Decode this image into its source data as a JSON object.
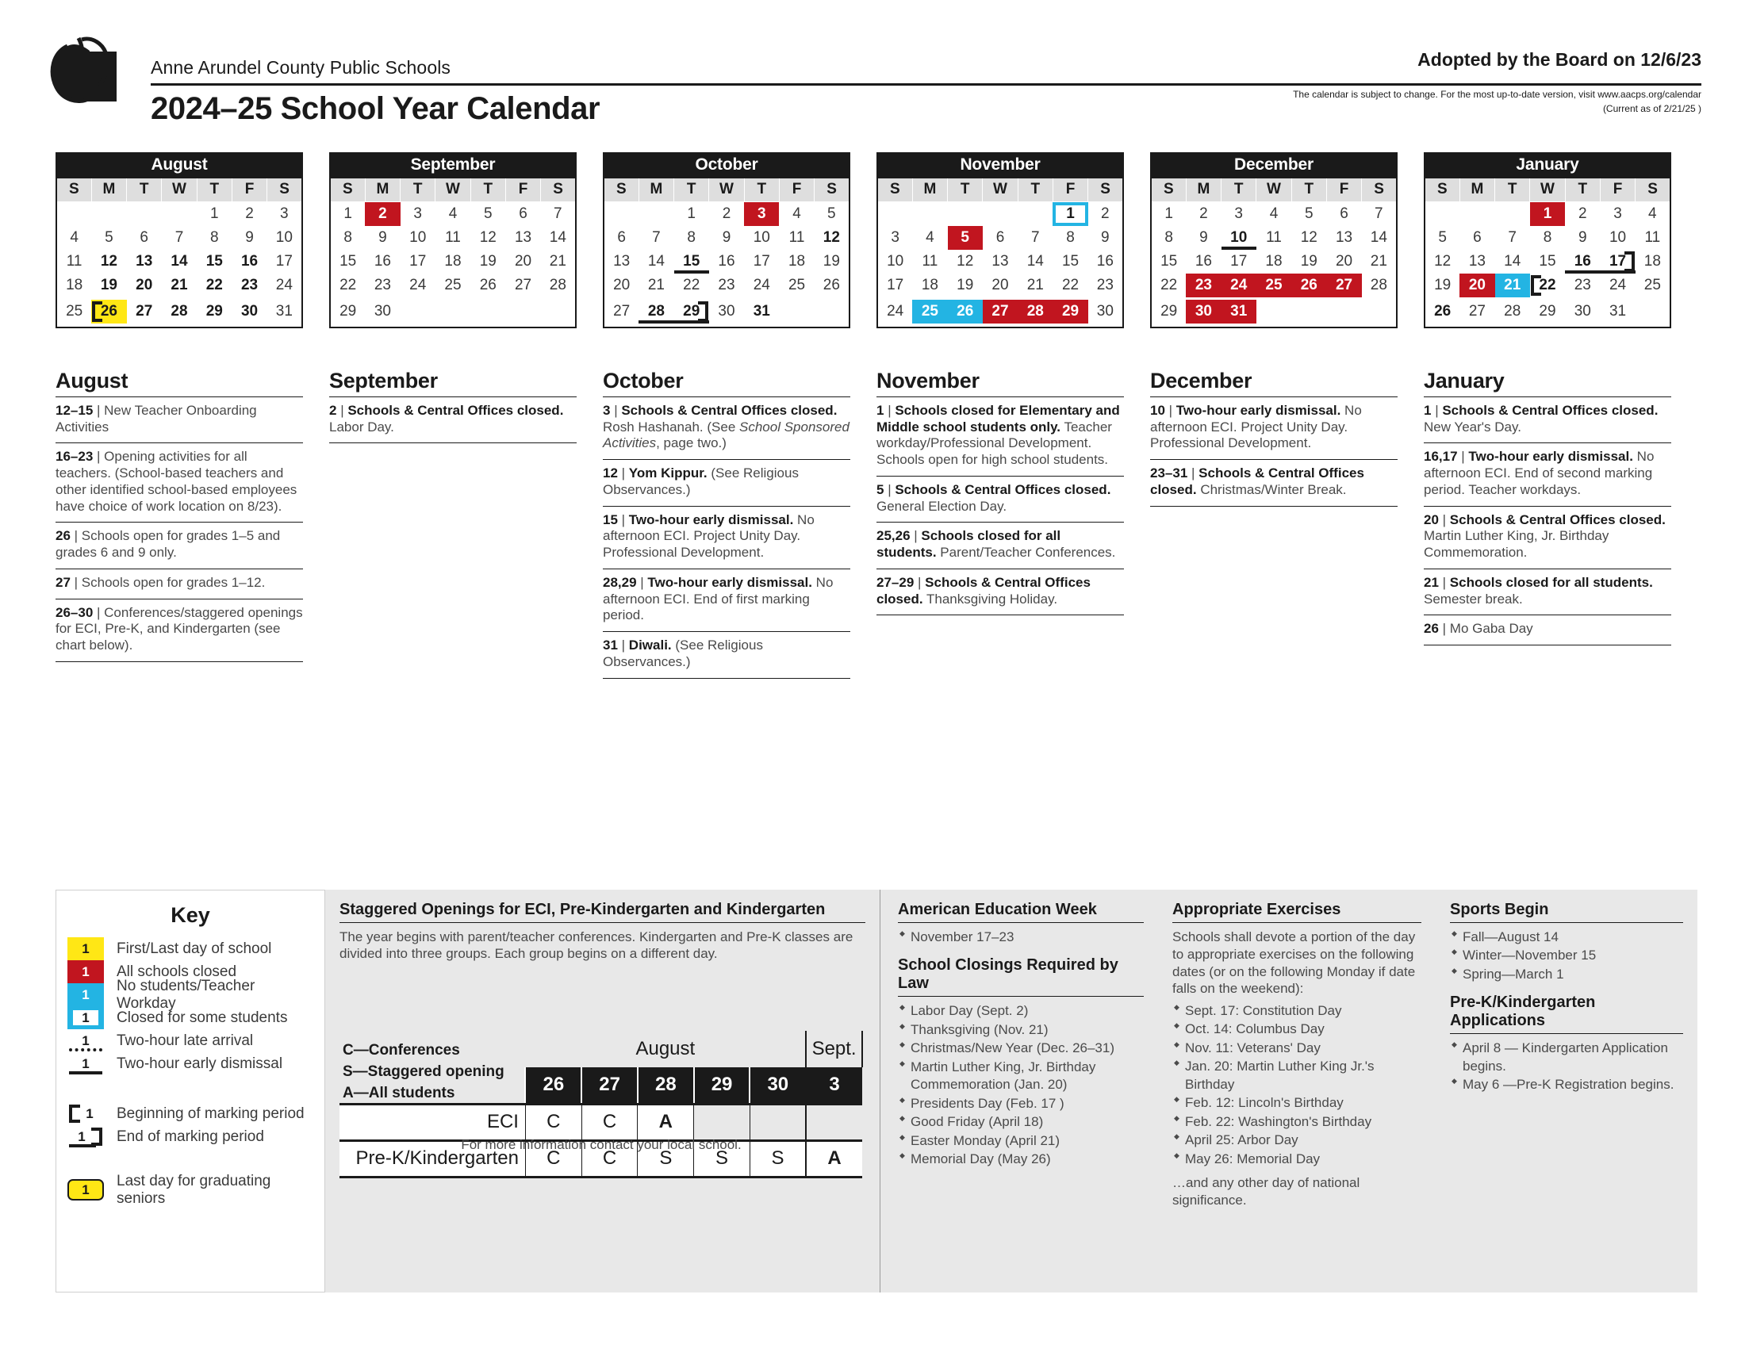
{
  "header": {
    "org": "Anne Arundel County Public Schools",
    "title": "2024–25 School Year Calendar",
    "adopted": "Adopted by the Board on 12/6/23",
    "note1": "The calendar is subject to change. For the most up-to-date version, visit www.aacps.org/calendar",
    "note2": "(Current as of 2/21/25 )",
    "logo_icon": "apple-logo-icon"
  },
  "colors": {
    "red": "#c1151f",
    "cyan": "#23b4e3",
    "yellow": "#ffe715",
    "black": "#1a1a1a",
    "header_gray": "#dedede",
    "panel_gray": "#e8e8e8"
  },
  "weekday_headers": [
    "S",
    "M",
    "T",
    "W",
    "T",
    "F",
    "S"
  ],
  "months": [
    {
      "name": "August",
      "weeks": [
        [
          null,
          null,
          null,
          null,
          {
            "d": "1"
          },
          {
            "d": "2"
          },
          {
            "d": "3"
          }
        ],
        [
          {
            "d": "4"
          },
          {
            "d": "5"
          },
          {
            "d": "6"
          },
          {
            "d": "7"
          },
          {
            "d": "8"
          },
          {
            "d": "9"
          },
          {
            "d": "10"
          }
        ],
        [
          {
            "d": "11"
          },
          {
            "d": "12",
            "s": "bold"
          },
          {
            "d": "13",
            "s": "bold"
          },
          {
            "d": "14",
            "s": "bold"
          },
          {
            "d": "15",
            "s": "bold"
          },
          {
            "d": "16",
            "s": "bold"
          },
          {
            "d": "17"
          }
        ],
        [
          {
            "d": "18"
          },
          {
            "d": "19",
            "s": "bold"
          },
          {
            "d": "20",
            "s": "bold"
          },
          {
            "d": "21",
            "s": "bold"
          },
          {
            "d": "22",
            "s": "bold"
          },
          {
            "d": "23",
            "s": "bold"
          },
          {
            "d": "24"
          }
        ],
        [
          {
            "d": "25"
          },
          {
            "d": "26",
            "s": "yellow mp-start"
          },
          {
            "d": "27",
            "s": "bold"
          },
          {
            "d": "28",
            "s": "bold"
          },
          {
            "d": "29",
            "s": "bold"
          },
          {
            "d": "30",
            "s": "bold"
          },
          {
            "d": "31"
          }
        ]
      ]
    },
    {
      "name": "September",
      "weeks": [
        [
          {
            "d": "1"
          },
          {
            "d": "2",
            "s": "red"
          },
          {
            "d": "3"
          },
          {
            "d": "4"
          },
          {
            "d": "5"
          },
          {
            "d": "6"
          },
          {
            "d": "7"
          }
        ],
        [
          {
            "d": "8"
          },
          {
            "d": "9"
          },
          {
            "d": "10"
          },
          {
            "d": "11"
          },
          {
            "d": "12"
          },
          {
            "d": "13"
          },
          {
            "d": "14"
          }
        ],
        [
          {
            "d": "15"
          },
          {
            "d": "16"
          },
          {
            "d": "17"
          },
          {
            "d": "18"
          },
          {
            "d": "19"
          },
          {
            "d": "20"
          },
          {
            "d": "21"
          }
        ],
        [
          {
            "d": "22"
          },
          {
            "d": "23"
          },
          {
            "d": "24"
          },
          {
            "d": "25"
          },
          {
            "d": "26"
          },
          {
            "d": "27"
          },
          {
            "d": "28"
          }
        ],
        [
          {
            "d": "29"
          },
          {
            "d": "30"
          },
          null,
          null,
          null,
          null,
          null
        ]
      ]
    },
    {
      "name": "October",
      "weeks": [
        [
          null,
          null,
          {
            "d": "1"
          },
          {
            "d": "2"
          },
          {
            "d": "3",
            "s": "red"
          },
          {
            "d": "4"
          },
          {
            "d": "5"
          }
        ],
        [
          {
            "d": "6"
          },
          {
            "d": "7"
          },
          {
            "d": "8"
          },
          {
            "d": "9"
          },
          {
            "d": "10"
          },
          {
            "d": "11"
          },
          {
            "d": "12",
            "s": "bold"
          }
        ],
        [
          {
            "d": "13"
          },
          {
            "d": "14"
          },
          {
            "d": "15",
            "s": "bold under"
          },
          {
            "d": "16"
          },
          {
            "d": "17"
          },
          {
            "d": "18"
          },
          {
            "d": "19"
          }
        ],
        [
          {
            "d": "20"
          },
          {
            "d": "21"
          },
          {
            "d": "22"
          },
          {
            "d": "23"
          },
          {
            "d": "24"
          },
          {
            "d": "25"
          },
          {
            "d": "26"
          }
        ],
        [
          {
            "d": "27"
          },
          {
            "d": "28",
            "s": "bold under"
          },
          {
            "d": "29",
            "s": "bold under mp-end"
          },
          {
            "d": "30"
          },
          {
            "d": "31",
            "s": "bold"
          },
          null,
          null
        ]
      ]
    },
    {
      "name": "November",
      "weeks": [
        [
          null,
          null,
          null,
          null,
          null,
          {
            "d": "1",
            "s": "outline"
          },
          {
            "d": "2"
          }
        ],
        [
          {
            "d": "3"
          },
          {
            "d": "4"
          },
          {
            "d": "5",
            "s": "red"
          },
          {
            "d": "6"
          },
          {
            "d": "7"
          },
          {
            "d": "8"
          },
          {
            "d": "9"
          }
        ],
        [
          {
            "d": "10"
          },
          {
            "d": "11"
          },
          {
            "d": "12"
          },
          {
            "d": "13"
          },
          {
            "d": "14"
          },
          {
            "d": "15"
          },
          {
            "d": "16"
          }
        ],
        [
          {
            "d": "17"
          },
          {
            "d": "18"
          },
          {
            "d": "19"
          },
          {
            "d": "20"
          },
          {
            "d": "21"
          },
          {
            "d": "22"
          },
          {
            "d": "23"
          }
        ],
        [
          {
            "d": "24"
          },
          {
            "d": "25",
            "s": "cyan"
          },
          {
            "d": "26",
            "s": "cyan"
          },
          {
            "d": "27",
            "s": "red"
          },
          {
            "d": "28",
            "s": "red"
          },
          {
            "d": "29",
            "s": "red"
          },
          {
            "d": "30"
          }
        ]
      ]
    },
    {
      "name": "December",
      "weeks": [
        [
          {
            "d": "1"
          },
          {
            "d": "2"
          },
          {
            "d": "3"
          },
          {
            "d": "4"
          },
          {
            "d": "5"
          },
          {
            "d": "6"
          },
          {
            "d": "7"
          }
        ],
        [
          {
            "d": "8"
          },
          {
            "d": "9"
          },
          {
            "d": "10",
            "s": "bold under"
          },
          {
            "d": "11"
          },
          {
            "d": "12"
          },
          {
            "d": "13"
          },
          {
            "d": "14"
          }
        ],
        [
          {
            "d": "15"
          },
          {
            "d": "16"
          },
          {
            "d": "17"
          },
          {
            "d": "18"
          },
          {
            "d": "19"
          },
          {
            "d": "20"
          },
          {
            "d": "21"
          }
        ],
        [
          {
            "d": "22"
          },
          {
            "d": "23",
            "s": "red"
          },
          {
            "d": "24",
            "s": "red"
          },
          {
            "d": "25",
            "s": "red"
          },
          {
            "d": "26",
            "s": "red"
          },
          {
            "d": "27",
            "s": "red"
          },
          {
            "d": "28"
          }
        ],
        [
          {
            "d": "29"
          },
          {
            "d": "30",
            "s": "red"
          },
          {
            "d": "31",
            "s": "red"
          },
          null,
          null,
          null,
          null
        ]
      ]
    },
    {
      "name": "January",
      "weeks": [
        [
          null,
          null,
          null,
          {
            "d": "1",
            "s": "red"
          },
          {
            "d": "2"
          },
          {
            "d": "3"
          },
          {
            "d": "4"
          }
        ],
        [
          {
            "d": "5"
          },
          {
            "d": "6"
          },
          {
            "d": "7"
          },
          {
            "d": "8"
          },
          {
            "d": "9"
          },
          {
            "d": "10"
          },
          {
            "d": "11"
          }
        ],
        [
          {
            "d": "12"
          },
          {
            "d": "13"
          },
          {
            "d": "14"
          },
          {
            "d": "15"
          },
          {
            "d": "16",
            "s": "bold under"
          },
          {
            "d": "17",
            "s": "bold under mp-end"
          },
          {
            "d": "18"
          }
        ],
        [
          {
            "d": "19"
          },
          {
            "d": "20",
            "s": "red"
          },
          {
            "d": "21",
            "s": "cyan"
          },
          {
            "d": "22",
            "s": "bold mp-start"
          },
          {
            "d": "23"
          },
          {
            "d": "24"
          },
          {
            "d": "25"
          }
        ],
        [
          {
            "d": "26",
            "s": "bold"
          },
          {
            "d": "27"
          },
          {
            "d": "28"
          },
          {
            "d": "29"
          },
          {
            "d": "30"
          },
          {
            "d": "31"
          },
          null
        ]
      ]
    }
  ],
  "notes": [
    {
      "month": "August",
      "items": [
        {
          "date": "12–15",
          "bold": "",
          "rest": "New Teacher Onboarding Activities"
        },
        {
          "date": "16–23",
          "bold": "",
          "rest": "Opening activities for all teachers. (School-based teachers and other identified school-based employees have choice of work location on 8/23)."
        },
        {
          "date": "26",
          "bold": "",
          "rest": "Schools open for grades 1–5 and grades 6 and 9 only."
        },
        {
          "date": "27",
          "bold": "",
          "rest": "Schools open for grades 1–12."
        },
        {
          "date": "26–30",
          "bold": "",
          "rest": "Conferences/staggered openings for ECI, Pre-K, and Kindergarten  (see chart below)."
        }
      ]
    },
    {
      "month": "September",
      "items": [
        {
          "date": "2",
          "bold": "Schools & Central Offices closed.",
          "rest": " Labor Day."
        }
      ]
    },
    {
      "month": "October",
      "items": [
        {
          "date": "3",
          "bold": "Schools & Central Offices closed.",
          "rest": " Rosh Hashanah. (See School Sponsored Activities, page two.)",
          "italic": "School Sponsored Activities"
        },
        {
          "date": "12",
          "bold": "Yom Kippur.",
          "rest": " (See Religious Observances.)"
        },
        {
          "date": "15",
          "bold": "Two-hour early dismissal.",
          "rest": " No afternoon ECI. Project Unity Day. Professional Development."
        },
        {
          "date": "28,29",
          "bold": "Two-hour early dismissal.",
          "rest": " No afternoon ECI. End of first marking period."
        },
        {
          "date": "31",
          "bold": "Diwali.",
          "rest": " (See Religious Observances.)"
        }
      ]
    },
    {
      "month": "November",
      "items": [
        {
          "date": "1",
          "bold": "Schools closed for Elementary and Middle school students only.",
          "rest": " Teacher workday/Professional Development. Schools open for high school students."
        },
        {
          "date": "5",
          "bold": "Schools & Central Offices closed.",
          "rest": " General Election Day."
        },
        {
          "date": "25,26",
          "bold": "Schools closed for all students.",
          "rest": " Parent/Teacher Conferences."
        },
        {
          "date": "27–29",
          "bold": "Schools & Central Offices closed.",
          "rest": " Thanksgiving Holiday."
        }
      ]
    },
    {
      "month": "December",
      "items": [
        {
          "date": "10",
          "bold": "Two-hour early dismissal.",
          "rest": " No afternoon ECI. Project Unity Day. Professional Development."
        },
        {
          "date": "23–31",
          "bold": "Schools & Central Offices closed.",
          "rest": " Christmas/Winter Break."
        }
      ]
    },
    {
      "month": "January",
      "items": [
        {
          "date": "1",
          "bold": "Schools & Central Offices closed.",
          "rest": " New Year's Day."
        },
        {
          "date": "16,17",
          "bold": "Two-hour early dismissal.",
          "rest": " No afternoon ECI. End of second marking period. Teacher workdays."
        },
        {
          "date": "20",
          "bold": "Schools & Central Offices closed.",
          "rest": " Martin Luther King, Jr. Birthday Commemoration."
        },
        {
          "date": "21",
          "bold": "Schools closed for all students.",
          "rest": " Semester break."
        },
        {
          "date": "26",
          "bold": "",
          "rest": "Mo Gaba Day"
        }
      ]
    }
  ],
  "key": {
    "title": "Key",
    "sample": "1",
    "rows": [
      {
        "type": "yellow",
        "label": "First/Last day of school"
      },
      {
        "type": "red",
        "label": "All schools closed"
      },
      {
        "type": "cyan",
        "label": "No students/Teacher Workday"
      },
      {
        "type": "outline",
        "label": "Closed for some students"
      },
      {
        "type": "dotted",
        "label": "Two-hour late arrival"
      },
      {
        "type": "solid",
        "label": "Two-hour early dismissal"
      },
      {
        "type": "mp-start",
        "label": "Beginning of marking period"
      },
      {
        "type": "mp-end",
        "label": "End of marking period"
      },
      {
        "type": "senior",
        "label": "Last day for graduating seniors"
      }
    ]
  },
  "staggered": {
    "heading": "Staggered Openings for ECI, Pre-Kindergarten and Kindergarten",
    "lead": "The year begins with parent/teacher conferences. Kindergarten and Pre-K classes are divided into three groups. Each group begins on a different day.",
    "legend": [
      "C—Conferences",
      "S—Staggered opening",
      "A—All students"
    ],
    "month_label": "August",
    "month_label2": "Sept.",
    "days": [
      "26",
      "27",
      "28",
      "29",
      "30",
      "3"
    ],
    "rows": [
      {
        "label": "ECI",
        "cells": [
          "C",
          "C",
          "A",
          "",
          "",
          ""
        ]
      },
      {
        "label": "Pre-K/Kindergarten",
        "cells": [
          "C",
          "C",
          "S",
          "S",
          "S",
          "A"
        ]
      }
    ],
    "footer": "For more information contact your local school."
  },
  "american_education_week": {
    "heading": "American Education Week",
    "items": [
      "November 17–23"
    ]
  },
  "school_closings": {
    "heading": "School Closings Required by Law",
    "items": [
      "Labor Day (Sept. 2)",
      "Thanksgiving (Nov. 21)",
      "Christmas/New Year (Dec. 26–31)",
      "Martin Luther King, Jr. Birthday Commemoration (Jan. 20)",
      "Presidents Day (Feb. 17 )",
      "Good Friday (April 18)",
      "Easter Monday (April 21)",
      "Memorial Day (May 26)"
    ]
  },
  "appropriate_exercises": {
    "heading": "Appropriate Exercises",
    "lead": "Schools shall devote a portion of the day to appropriate exercises on the following dates (or on the following Monday if date falls on the weekend):",
    "items": [
      "Sept. 17: Constitution Day",
      "Oct. 14: Columbus Day",
      "Nov. 11: Veterans' Day",
      "Jan. 20: Martin Luther King Jr.'s Birthday",
      "Feb. 12: Lincoln's Birthday",
      "Feb. 22: Washington's Birthday",
      "April 25: Arbor Day",
      "May 26: Memorial Day"
    ],
    "tail": "…and any other day of national significance."
  },
  "sports_begin": {
    "heading": "Sports Begin",
    "items": [
      "Fall—August 14",
      "Winter—November 15",
      "Spring—March 1"
    ]
  },
  "prek_applications": {
    "heading": "Pre-K/Kindergarten Applications",
    "items": [
      "April 8 — Kindergarten Application begins.",
      "May 6 —Pre-K Registration begins."
    ]
  }
}
